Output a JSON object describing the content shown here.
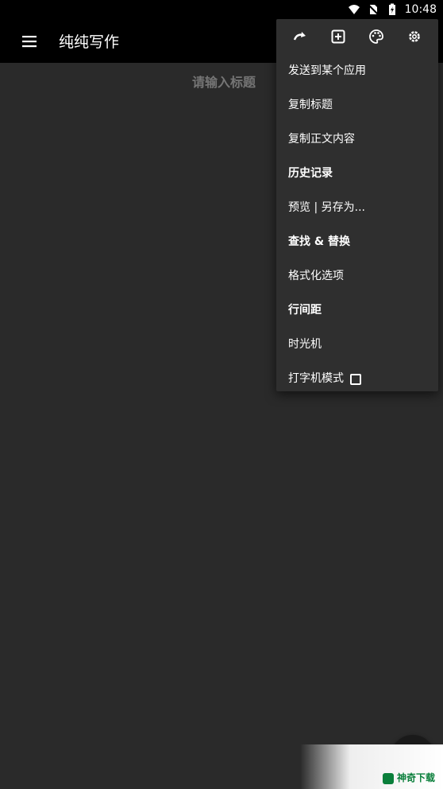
{
  "status_bar": {
    "time": "10:48",
    "icons": [
      "wifi-icon",
      "no-sim-icon",
      "battery-charging-icon"
    ]
  },
  "toolbar": {
    "menu_icon": "hamburger-menu-icon",
    "title": "纯纯写作"
  },
  "editor": {
    "title_placeholder": "请输入标题"
  },
  "popup_menu": {
    "icon_row": [
      "redo-icon",
      "add-box-icon",
      "palette-icon",
      "settings-gear-icon"
    ],
    "items": [
      {
        "label": "发送到某个应用",
        "bold": false
      },
      {
        "label": "复制标题",
        "bold": false
      },
      {
        "label": "复制正文内容",
        "bold": false
      },
      {
        "label": "历史记录",
        "bold": true
      },
      {
        "label": "预览 | 另存为...",
        "bold": false
      },
      {
        "label": "查找 & 替换",
        "bold": true
      },
      {
        "label": "格式化选项",
        "bold": false
      },
      {
        "label": "行间距",
        "bold": true
      },
      {
        "label": "时光机",
        "bold": false
      },
      {
        "label": "打字机模式",
        "bold": false,
        "checkbox": "unchecked"
      }
    ]
  },
  "watermark": {
    "text": "神奇下载"
  },
  "colors": {
    "status_bar": "#000000",
    "toolbar": "#000000",
    "background": "#2a2a2a",
    "popup": "#2f2f2f",
    "placeholder": "#8d8d8d"
  }
}
